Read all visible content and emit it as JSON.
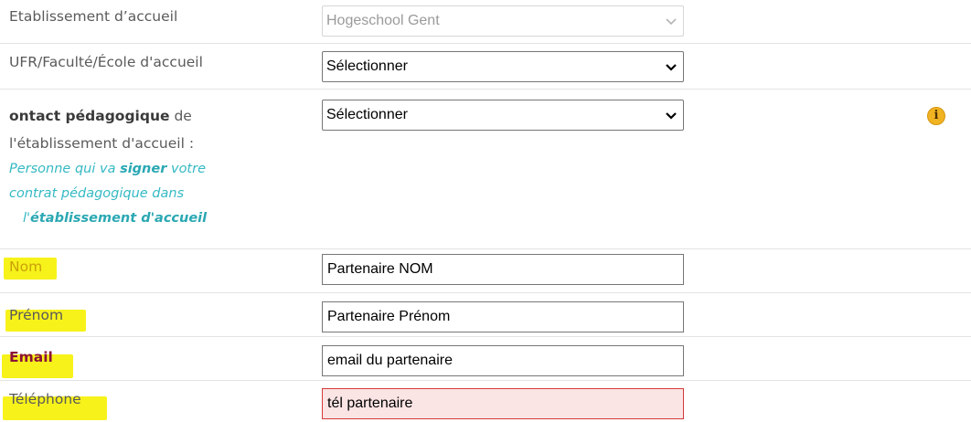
{
  "form": {
    "etablissement": {
      "label": "Etablissement d’accueil",
      "value": "Hogeschool Gent",
      "disabled": true
    },
    "ufr": {
      "label": "UFR/Faculté/École d'accueil",
      "value": "Sélectionner"
    },
    "contact": {
      "label_bold": "ontact pédagogique",
      "label_rest": " de",
      "label_line2": "l'établissement d'accueil :",
      "hint_part1": "Personne qui va ",
      "hint_bold1": "signer",
      "hint_part2": " votre",
      "hint_line2": "contrat pédagogique dans",
      "hint_part3": "l'",
      "hint_bold2": "établissement d'accueil",
      "value": "Sélectionner",
      "info_icon": "info-icon",
      "info_glyph": "i"
    },
    "nom": {
      "label": "Nom",
      "value": "Partenaire NOM"
    },
    "prenom": {
      "label": "Prénom",
      "value": "Partenaire Prénom"
    },
    "email": {
      "label": "Email",
      "value": "email du partenaire"
    },
    "telephone": {
      "label": "Téléphone",
      "value": "tél partenaire",
      "error": true
    }
  },
  "colors": {
    "highlight": "#f7f21a",
    "hint": "#35b9c4",
    "email_label": "#8b1238",
    "error_border": "#d63a3a",
    "error_bg": "#fbe4e4",
    "info": "#f0b321"
  }
}
